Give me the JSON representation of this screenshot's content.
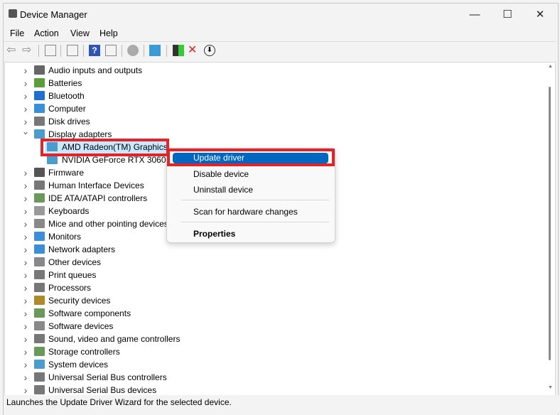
{
  "window": {
    "title": "Device Manager",
    "minimize": "—",
    "maximize": "☐",
    "close": "✕"
  },
  "menu": [
    "File",
    "Action",
    "View",
    "Help"
  ],
  "toolbar": [
    "back",
    "forward",
    "show-hide-console-tree",
    "properties",
    "help",
    "action-pane",
    "scan-hardware",
    "monitor",
    "update-driver",
    "uninstall",
    "disable"
  ],
  "tree": {
    "items": [
      {
        "label": "Audio inputs and outputs",
        "color": "#666"
      },
      {
        "label": "Batteries",
        "color": "#5a9e3a"
      },
      {
        "label": "Bluetooth",
        "color": "#1f6fd1"
      },
      {
        "label": "Computer",
        "color": "#3b8ed8"
      },
      {
        "label": "Disk drives",
        "color": "#777"
      },
      {
        "label": "Display adapters",
        "color": "#4a9ccf",
        "expanded": true
      },
      {
        "label": "AMD Radeon(TM) Graphics",
        "color": "#4a9ccf",
        "child": true,
        "selected": true
      },
      {
        "label": "NVIDIA GeForce RTX 3060 Laptop GPU",
        "color": "#4a9ccf",
        "child": true
      },
      {
        "label": "Firmware",
        "color": "#555"
      },
      {
        "label": "Human Interface Devices",
        "color": "#777"
      },
      {
        "label": "IDE ATA/ATAPI controllers",
        "color": "#6a9a5a"
      },
      {
        "label": "Keyboards",
        "color": "#999"
      },
      {
        "label": "Mice and other pointing devices",
        "color": "#888"
      },
      {
        "label": "Monitors",
        "color": "#3b8ed8"
      },
      {
        "label": "Network adapters",
        "color": "#3b8ed8"
      },
      {
        "label": "Other devices",
        "color": "#888"
      },
      {
        "label": "Print queues",
        "color": "#777"
      },
      {
        "label": "Processors",
        "color": "#777"
      },
      {
        "label": "Security devices",
        "color": "#b08a2a"
      },
      {
        "label": "Software components",
        "color": "#6a9a5a"
      },
      {
        "label": "Software devices",
        "color": "#888"
      },
      {
        "label": "Sound, video and game controllers",
        "color": "#777"
      },
      {
        "label": "Storage controllers",
        "color": "#6a9a5a"
      },
      {
        "label": "System devices",
        "color": "#4a9ccf"
      },
      {
        "label": "Universal Serial Bus controllers",
        "color": "#777"
      },
      {
        "label": "Universal Serial Bus devices",
        "color": "#777"
      }
    ]
  },
  "context_menu": {
    "update": "Update driver",
    "disable": "Disable device",
    "uninstall": "Uninstall device",
    "scan": "Scan for hardware changes",
    "properties": "Properties"
  },
  "status": "Launches the Update Driver Wizard for the selected device.",
  "colors": {
    "highlight": "#0067c0",
    "annotation": "#e2232a",
    "selection": "#cce8ff"
  }
}
